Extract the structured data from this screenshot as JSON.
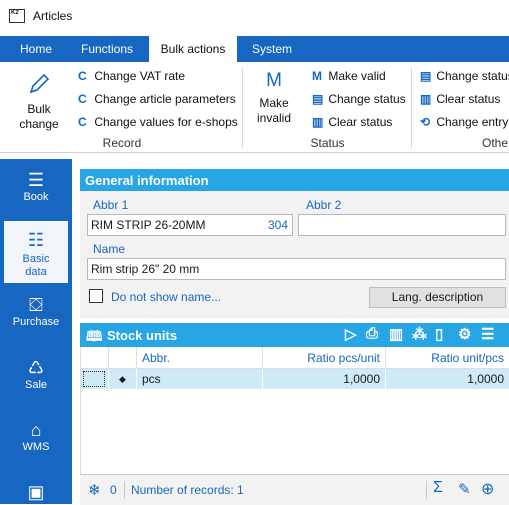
{
  "window": {
    "app_icon_text": "K2",
    "title": "Articles"
  },
  "ribbon": {
    "tabs": [
      {
        "label": "Home"
      },
      {
        "label": "Functions"
      },
      {
        "label": "Bulk actions"
      },
      {
        "label": "System"
      }
    ],
    "active_tab": "Bulk actions",
    "groups": {
      "record": {
        "label": "Record",
        "bulk_change": "Bulk change",
        "items": [
          "Change VAT rate",
          "Change article parameters",
          "Change values for e-shops"
        ]
      },
      "status": {
        "label": "Status",
        "make_invalid": "Make invalid",
        "items": [
          "Make valid",
          "Change status",
          "Clear status"
        ]
      },
      "other": {
        "label": "Othe",
        "items": [
          "Change status",
          "Clear status",
          "Change entry"
        ]
      }
    }
  },
  "leftnav": {
    "items": [
      {
        "label": "Book",
        "icon": "menu-lines-icon"
      },
      {
        "label": "Basic data",
        "icon": "list-icon"
      },
      {
        "label": "Purchase",
        "icon": "purchase-icon"
      },
      {
        "label": "Sale",
        "icon": "sale-icon"
      },
      {
        "label": "WMS",
        "icon": "warehouse-icon"
      }
    ],
    "active": "Basic data"
  },
  "general_info": {
    "title": "General information",
    "abbr1_label": "Abbr 1",
    "abbr1_value": "RIM STRIP 26-20MM",
    "abbr1_code": "304",
    "abbr2_label": "Abbr 2",
    "abbr2_value": "",
    "name_label": "Name",
    "name_value": "Rim strip 26\" 20 mm",
    "do_not_show_label": "Do not show name...",
    "do_not_show_checked": false,
    "lang_button": "Lang. description"
  },
  "stock_units": {
    "title": "Stock units",
    "columns": [
      "Abbr.",
      "Ratio pcs/unit",
      "Ratio unit/pcs"
    ],
    "rows": [
      {
        "abbr": "pcs",
        "ratio_pcs_unit": "1,0000",
        "ratio_unit_pcs": "1,0000"
      }
    ],
    "footer": {
      "filter_count": "0",
      "records_text": "Number of records: 1"
    }
  },
  "colors": {
    "accent": "#1766c2",
    "header": "#27a5e4",
    "selected_row": "#cfeaf7"
  }
}
